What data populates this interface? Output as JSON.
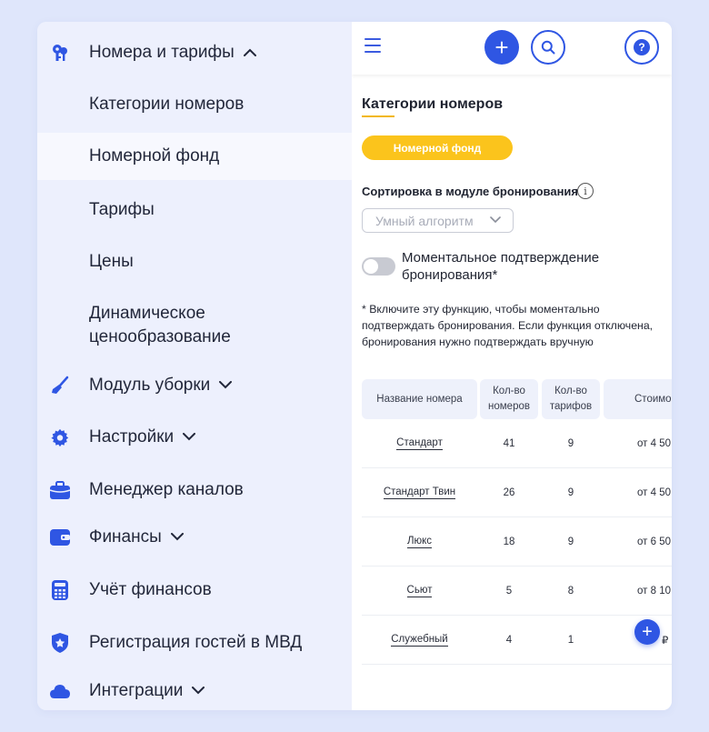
{
  "sidebar": {
    "section_rooms": "Номера и тарифы",
    "sub_items": [
      "Категории номеров",
      "Номерной фонд",
      "Тарифы",
      "Цены",
      "Динамическое ценообразование"
    ],
    "cleaning": "Модуль уборки",
    "settings": "Настройки",
    "channels": "Менеджер каналов",
    "finance": "Финансы",
    "accounting": "Учёт финансов",
    "registration": "Регистрация гостей в МВД",
    "integrations": "Интеграции",
    "active_item": "Номерной фонд",
    "accent_color": "#2f56e3"
  },
  "topbar": {
    "menu_icon": "hamburger-icon",
    "add_icon": "plus-icon",
    "search_icon": "search-icon",
    "help_icon": "question-icon",
    "help_glyph": "?",
    "plus_glyph": "+"
  },
  "main": {
    "title": "Категории номеров",
    "tab_label": "Номерной фонд",
    "sort_label": "Сортировка в модуле бронирования",
    "info_glyph": "i",
    "sort_select_value": "Умный алгоритм",
    "toggle_label": "Моментальное подтверждение бронирования*",
    "toggle_on": false,
    "note": "* Включите эту функцию, чтобы моментально подтверждать бронирования. Если функция отключена, бронирования нужно подтверждать вручную"
  },
  "table": {
    "headers": [
      "Название номера",
      "Кол-во номеров",
      "Кол-во тарифов",
      "Стоимо"
    ],
    "rows": [
      {
        "name": "Стандарт",
        "rooms": "41",
        "tariffs": "9",
        "price": "от 4 50"
      },
      {
        "name": "Стандарт Твин",
        "rooms": "26",
        "tariffs": "9",
        "price": "от 4 50"
      },
      {
        "name": "Люкс",
        "rooms": "18",
        "tariffs": "9",
        "price": "от 6 50"
      },
      {
        "name": "Сьют",
        "rooms": "5",
        "tariffs": "8",
        "price": "от 8 10"
      },
      {
        "name": "Служебный",
        "rooms": "4",
        "tariffs": "1",
        "price": "₽"
      }
    ]
  },
  "fab_glyph": "+"
}
